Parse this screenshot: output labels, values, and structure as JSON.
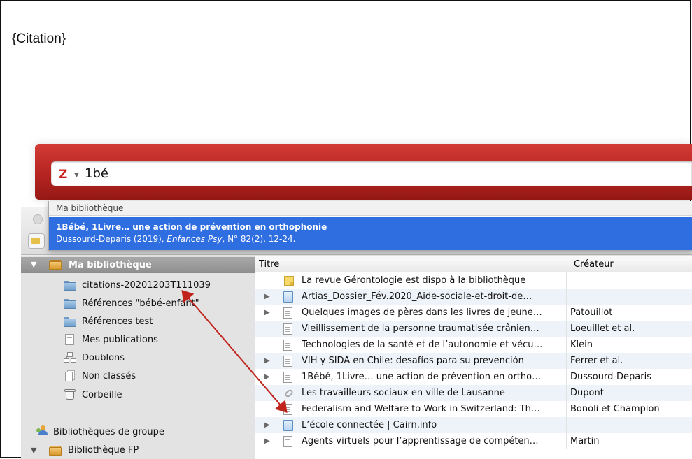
{
  "document": {
    "placeholder": "{Citation}"
  },
  "quick_format": {
    "search_text": "1bé",
    "logo": "Z"
  },
  "dropdown": {
    "header": "Ma bibliothèque",
    "result_title": "1Bébé, 1Livre… une action de prévention en orthophonie",
    "result_sub_prefix": "Dussourd-Deparis (2019), ",
    "result_sub_journal": "Enfances Psy",
    "result_sub_suffix": ", N° 82(2), 12-24."
  },
  "sidebar": {
    "library_label": "Ma bibliothèque",
    "items": [
      {
        "label": "citations-20201203T111039",
        "icon": "folder-icon"
      },
      {
        "label": "Références \"bébé-enfant\"",
        "icon": "folder-icon"
      },
      {
        "label": "Références test",
        "icon": "folder-icon"
      },
      {
        "label": "Mes publications",
        "icon": "document-icon"
      },
      {
        "label": "Doublons",
        "icon": "duplicates-icon"
      },
      {
        "label": "Non classés",
        "icon": "unfiled-icon"
      },
      {
        "label": "Corbeille",
        "icon": "trash-icon"
      }
    ],
    "group_libraries_label": "Bibliothèques de groupe",
    "group_library_label": "Bibliothèque FP"
  },
  "items_pane": {
    "columns": {
      "title": "Titre",
      "creator": "Créateur"
    },
    "rows": [
      {
        "title": "La revue Gérontologie est dispo à la bibliothèque",
        "creator": "",
        "icon": "note-icon",
        "expandable": false
      },
      {
        "title": "Artias_Dossier_Fév.2020_Aide-sociale-et-droit-de…",
        "creator": "",
        "icon": "webpage-icon",
        "expandable": true
      },
      {
        "title": "Quelques images de pères dans les livres de jeune…",
        "creator": "Patouillot",
        "icon": "document-icon",
        "expandable": true
      },
      {
        "title": "Vieillissement de la personne traumatisée crânien…",
        "creator": "Loeuillet et al.",
        "icon": "document-icon",
        "expandable": false
      },
      {
        "title": "Technologies de la santé et de l’autonomie et vécu…",
        "creator": "Klein",
        "icon": "document-icon",
        "expandable": false
      },
      {
        "title": "VIH y SIDA en Chile: desafíos para su prevención",
        "creator": "Ferrer et al.",
        "icon": "document-icon",
        "expandable": true
      },
      {
        "title": "1Bébé, 1Livre… une action de prévention en ortho…",
        "creator": "Dussourd-Deparis",
        "icon": "document-icon",
        "expandable": true
      },
      {
        "title": "Les travailleurs sociaux en ville de Lausanne",
        "creator": "Dupont",
        "icon": "link-icon",
        "expandable": false
      },
      {
        "title": "Federalism and Welfare to Work in Switzerland: Th…",
        "creator": "Bonoli et Champion",
        "icon": "document-icon",
        "expandable": false
      },
      {
        "title": "L’école connectée | Cairn.info",
        "creator": "",
        "icon": "webpage-icon",
        "expandable": true
      },
      {
        "title": "Agents virtuels pour l’apprentissage de compéten…",
        "creator": "Martin",
        "icon": "document-icon",
        "expandable": true
      }
    ]
  },
  "annotation": {
    "arrow_color": "#c0221c"
  }
}
